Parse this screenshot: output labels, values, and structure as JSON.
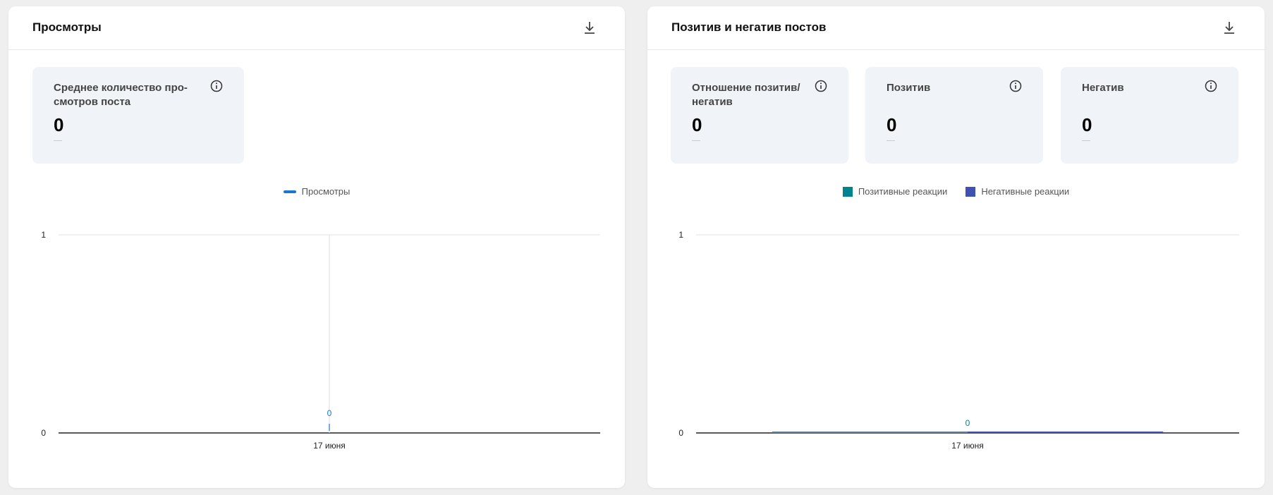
{
  "cards": [
    {
      "title": "Просмотры",
      "download_icon": "download-icon",
      "tiles": [
        {
          "title_lines": [
            "Среднее количество про-",
            "смотров поста"
          ],
          "value": "0",
          "change": "—"
        }
      ],
      "legend": [
        {
          "label": "Просмотры",
          "color": "#1976d2"
        }
      ]
    },
    {
      "title": "Позитив и негатив постов",
      "download_icon": "download-icon",
      "tiles": [
        {
          "title_lines": [
            "Отношение позитив/",
            "негатив"
          ],
          "value": "0",
          "change": "—"
        },
        {
          "title_lines": [
            "Позитив",
            ""
          ],
          "value": "0",
          "change": "—"
        },
        {
          "title_lines": [
            "Негатив",
            ""
          ],
          "value": "0",
          "change": "—"
        }
      ],
      "legend": [
        {
          "label": "Позитивные реакции",
          "color": "#00838f"
        },
        {
          "label": "Негативные реакции",
          "color": "#3f51b5"
        }
      ]
    }
  ],
  "chart_data": [
    {
      "type": "line",
      "title": "Просмотры",
      "categories": [
        "17 июня"
      ],
      "series": [
        {
          "name": "Просмотры",
          "values": [
            0
          ],
          "color": "#1976d2"
        }
      ],
      "ylim": [
        0,
        1
      ],
      "yticks": [
        "0",
        "1"
      ],
      "data_labels": [
        "0"
      ],
      "grid": true,
      "legend_placement": "top-center"
    },
    {
      "type": "bar",
      "title": "Позитив и негатив постов",
      "categories": [
        "17 июня"
      ],
      "series": [
        {
          "name": "Позитивные реакции",
          "values": [
            0
          ],
          "color": "#00838f"
        },
        {
          "name": "Негативные реакции",
          "values": [
            0
          ],
          "color": "#3f51b5"
        }
      ],
      "ylim": [
        0,
        1
      ],
      "yticks": [
        "0",
        "1"
      ],
      "data_labels": [
        "0"
      ],
      "grid": true,
      "legend_placement": "top-center"
    }
  ]
}
